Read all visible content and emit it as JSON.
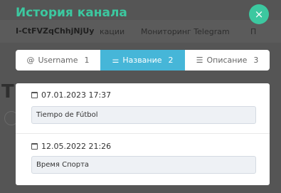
{
  "background": {
    "nav_item_a": "кации",
    "nav_item_b": "Мониторинг Telegram",
    "nav_item_c": "П",
    "big_letter": "Т"
  },
  "modal": {
    "title": "История канала",
    "channel_id": "I-CtFVZqChhjNjUy",
    "close_glyph": "×",
    "accent_color": "#3cc8a0",
    "active_tab_color": "#46b6d8"
  },
  "tabs": [
    {
      "label": "Username",
      "count": "1",
      "icon": "at-icon",
      "active": false
    },
    {
      "label": "Название",
      "count": "2",
      "icon": "minus-lines-icon",
      "active": true
    },
    {
      "label": "Описание",
      "count": "3",
      "icon": "list-lines-icon",
      "active": false
    }
  ],
  "entries": [
    {
      "date": "07.01.2023 17:37",
      "value": "Tiempo de Fútbol"
    },
    {
      "date": "12.05.2022 21:26",
      "value": "Время Спорта"
    }
  ]
}
